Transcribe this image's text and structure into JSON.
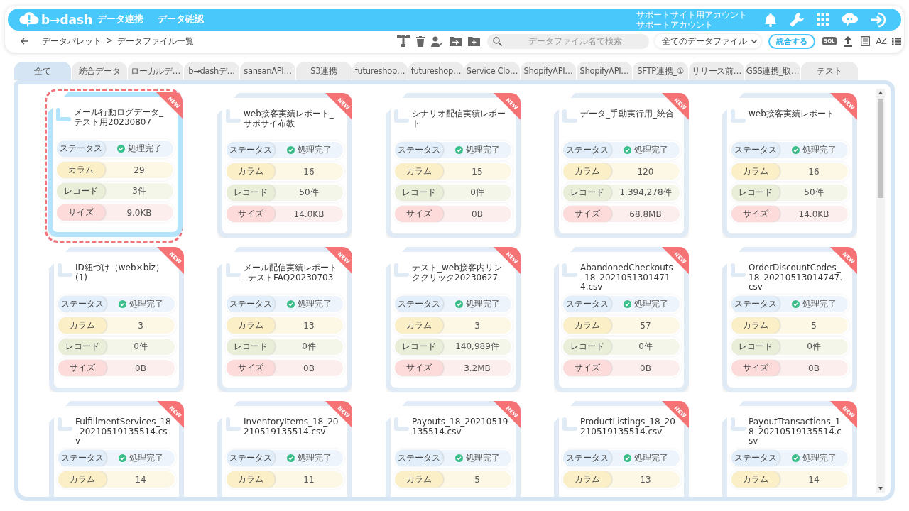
{
  "header": {
    "logo": "b→dash",
    "nav": [
      {
        "label": "データ連携"
      },
      {
        "label": "データ確認"
      }
    ],
    "account": [
      "サポートサイト用アカウント",
      "サポートアカウント"
    ]
  },
  "toolbar": {
    "breadcrumb": [
      "データパレット",
      ">",
      "データファイル一覧"
    ],
    "search": {
      "placeholder": "データファイル名で検索"
    },
    "filter": {
      "value": "全てのデータファイル"
    },
    "merge_button": "統合する",
    "sql_badge": "SQL",
    "sort_badge": "AZ"
  },
  "tabs": [
    {
      "label": "全て",
      "selected": true
    },
    {
      "label": "統合データ",
      "selected": false
    },
    {
      "label": "ローカルデ…",
      "selected": false
    },
    {
      "label": "b→dashデ…",
      "selected": false
    },
    {
      "label": "sansanAPI…",
      "selected": false
    },
    {
      "label": "S3連携",
      "selected": false
    },
    {
      "label": "futureshop…",
      "selected": false
    },
    {
      "label": "futureshop…",
      "selected": false
    },
    {
      "label": "Service Clo…",
      "selected": false
    },
    {
      "label": "ShopifyAPI…",
      "selected": false
    },
    {
      "label": "ShopifyAPI…",
      "selected": false
    },
    {
      "label": "SFTP連携_①",
      "selected": false
    },
    {
      "label": "リリース前…",
      "selected": false
    },
    {
      "label": "GSS連携_取…",
      "selected": false
    },
    {
      "label": "テスト",
      "selected": false
    }
  ],
  "files": [
    {
      "title": "メール行動ログデータ_テスト用20230807",
      "badge": "NEW",
      "selected": true,
      "fields": [
        {
          "kind": "status",
          "label": "ステータス",
          "value": "処理完了"
        },
        {
          "kind": "columns",
          "label": "カラム",
          "value": "29"
        },
        {
          "kind": "records",
          "label": "レコード",
          "value": "3件"
        },
        {
          "kind": "size",
          "label": "サイズ",
          "value": "9.0KB"
        }
      ]
    },
    {
      "title": "web接客実績レポート_サポサイ布教",
      "badge": "NEW",
      "selected": false,
      "fields": [
        {
          "kind": "status",
          "label": "ステータス",
          "value": "処理完了"
        },
        {
          "kind": "columns",
          "label": "カラム",
          "value": "16"
        },
        {
          "kind": "records",
          "label": "レコード",
          "value": "50件"
        },
        {
          "kind": "size",
          "label": "サイズ",
          "value": "14.0KB"
        }
      ]
    },
    {
      "title": "シナリオ配信実績レポート",
      "badge": "NEW",
      "selected": false,
      "fields": [
        {
          "kind": "status",
          "label": "ステータス",
          "value": "処理完了"
        },
        {
          "kind": "columns",
          "label": "カラム",
          "value": "15"
        },
        {
          "kind": "records",
          "label": "レコード",
          "value": "0件"
        },
        {
          "kind": "size",
          "label": "サイズ",
          "value": "0B"
        }
      ]
    },
    {
      "title": "データ_手動実行用_統合",
      "badge": "NEW",
      "selected": false,
      "fields": [
        {
          "kind": "status",
          "label": "ステータス",
          "value": "処理完了"
        },
        {
          "kind": "columns",
          "label": "カラム",
          "value": "120"
        },
        {
          "kind": "records",
          "label": "レコード",
          "value": "1,394,278件"
        },
        {
          "kind": "size",
          "label": "サイズ",
          "value": "68.8MB"
        }
      ]
    },
    {
      "title": "web接客実績レポート",
      "badge": "NEW",
      "selected": false,
      "fields": [
        {
          "kind": "status",
          "label": "ステータス",
          "value": "処理完了"
        },
        {
          "kind": "columns",
          "label": "カラム",
          "value": "16"
        },
        {
          "kind": "records",
          "label": "レコード",
          "value": "50件"
        },
        {
          "kind": "size",
          "label": "サイズ",
          "value": "14.0KB"
        }
      ]
    },
    {
      "title": "ID紐づけ（web×biz）(1)",
      "badge": "NEW",
      "selected": false,
      "fields": [
        {
          "kind": "status",
          "label": "ステータス",
          "value": "処理完了"
        },
        {
          "kind": "columns",
          "label": "カラム",
          "value": "3"
        },
        {
          "kind": "records",
          "label": "レコード",
          "value": "0件"
        },
        {
          "kind": "size",
          "label": "サイズ",
          "value": "0B"
        }
      ]
    },
    {
      "title": "メール配信実績レポート_テストFAQ20230703",
      "badge": "NEW",
      "selected": false,
      "fields": [
        {
          "kind": "status",
          "label": "ステータス",
          "value": "処理完了"
        },
        {
          "kind": "columns",
          "label": "カラム",
          "value": "13"
        },
        {
          "kind": "records",
          "label": "レコード",
          "value": "0件"
        },
        {
          "kind": "size",
          "label": "サイズ",
          "value": "0B"
        }
      ]
    },
    {
      "title": "テスト_web接客内リンククリック20230627",
      "badge": "NEW",
      "selected": false,
      "fields": [
        {
          "kind": "status",
          "label": "ステータス",
          "value": "処理完了"
        },
        {
          "kind": "columns",
          "label": "カラム",
          "value": "3"
        },
        {
          "kind": "records",
          "label": "レコード",
          "value": "140,989件"
        },
        {
          "kind": "size",
          "label": "サイズ",
          "value": "3.2MB"
        }
      ]
    },
    {
      "title": "AbandonedCheckouts_18_20210513014714.csv",
      "badge": "NEW",
      "selected": false,
      "fields": [
        {
          "kind": "status",
          "label": "ステータス",
          "value": "処理完了"
        },
        {
          "kind": "columns",
          "label": "カラム",
          "value": "57"
        },
        {
          "kind": "records",
          "label": "レコード",
          "value": "0件"
        },
        {
          "kind": "size",
          "label": "サイズ",
          "value": "0B"
        }
      ]
    },
    {
      "title": "OrderDiscountCodes_18_20210513014747.csv",
      "badge": "NEW",
      "selected": false,
      "fields": [
        {
          "kind": "status",
          "label": "ステータス",
          "value": "処理完了"
        },
        {
          "kind": "columns",
          "label": "カラム",
          "value": "5"
        },
        {
          "kind": "records",
          "label": "レコード",
          "value": "0件"
        },
        {
          "kind": "size",
          "label": "サイズ",
          "value": "0B"
        }
      ]
    },
    {
      "title": "FulfillmentServices_18_20210519135514.csv",
      "badge": "NEW",
      "selected": false,
      "fields": [
        {
          "kind": "status",
          "label": "ステータス",
          "value": "処理完了"
        },
        {
          "kind": "columns",
          "label": "カラム",
          "value": "14"
        }
      ]
    },
    {
      "title": "InventoryItems_18_20210519135514.csv",
      "badge": "NEW",
      "selected": false,
      "fields": [
        {
          "kind": "status",
          "label": "ステータス",
          "value": "処理完了"
        },
        {
          "kind": "columns",
          "label": "カラム",
          "value": "11"
        }
      ]
    },
    {
      "title": "Payouts_18_20210519135514.csv",
      "badge": "NEW",
      "selected": false,
      "fields": [
        {
          "kind": "status",
          "label": "ステータス",
          "value": "処理完了"
        },
        {
          "kind": "columns",
          "label": "カラム",
          "value": "5"
        }
      ]
    },
    {
      "title": "ProductListings_18_20210519135514.csv",
      "badge": "NEW",
      "selected": false,
      "fields": [
        {
          "kind": "status",
          "label": "ステータス",
          "value": "処理完了"
        },
        {
          "kind": "columns",
          "label": "カラム",
          "value": "13"
        }
      ]
    },
    {
      "title": "PayoutTransactions_18_20210519135514.csv",
      "badge": "NEW",
      "selected": false,
      "fields": [
        {
          "kind": "status",
          "label": "ステータス",
          "value": "処理完了"
        },
        {
          "kind": "columns",
          "label": "カラム",
          "value": "14"
        }
      ]
    }
  ]
}
